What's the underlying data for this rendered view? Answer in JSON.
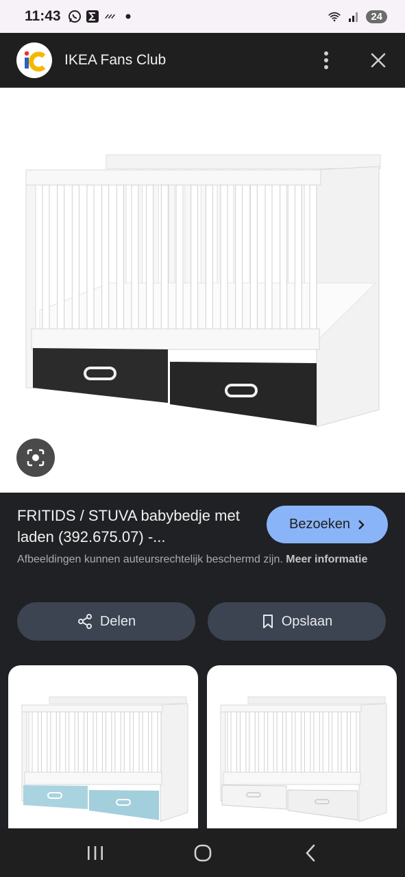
{
  "status_bar": {
    "time": "11:43",
    "battery": "24",
    "icons": [
      "whatsapp-icon",
      "sigma-icon",
      "wind-icon",
      "dot-icon",
      "wifi-icon",
      "signal-icon"
    ]
  },
  "header": {
    "logo_text": "iC",
    "title": "IKEA Fans Club",
    "more_icon": "more-vert-icon",
    "close_icon": "close-icon"
  },
  "result": {
    "title": "FRITIDS / STUVA babybedje met laden (392.675.07) -...",
    "visit_label": "Bezoeken",
    "copyright_text": "Afbeeldingen kunnen auteursrechtelijk beschermd zijn.",
    "more_info_label": "Meer informatie",
    "share_label": "Delen",
    "save_label": "Opslaan"
  },
  "colors": {
    "accent": "#8ab4f8",
    "drawer_black": "#2b2b2b",
    "drawer_blue": "#a9d3df",
    "drawer_white": "#f4f4f4"
  }
}
